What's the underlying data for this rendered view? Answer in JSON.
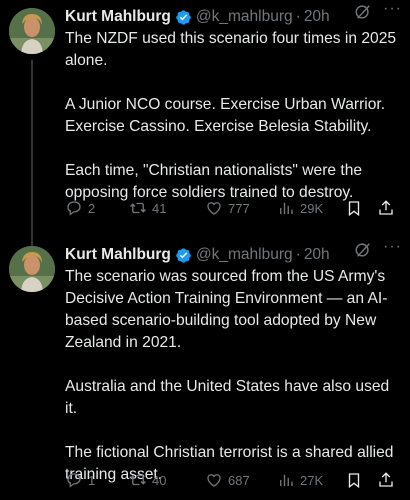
{
  "tweets": [
    {
      "author": "Kurt Mahlburg",
      "handle": "@k_mahlburg",
      "time": "20h",
      "paragraphs": [
        "The NZDF used this scenario four times in 2025 alone.",
        "A Junior NCO course. Exercise Urban Warrior. Exercise Cassino. Exercise Belesia Stability.",
        "Each time, \"Christian nationalists\" were the opposing force soldiers trained to destroy."
      ],
      "replies": "2",
      "reposts": "41",
      "likes": "777",
      "views": "29K"
    },
    {
      "author": "Kurt Mahlburg",
      "handle": "@k_mahlburg",
      "time": "20h",
      "paragraphs": [
        "The scenario was sourced from the US Army's Decisive Action Training Environment — an AI-based scenario-building tool adopted by New Zealand in 2021.",
        "Australia and the United States have also used it.",
        "The fictional Christian terrorist is a shared allied training asset."
      ],
      "replies": "1",
      "reposts": "40",
      "likes": "687",
      "views": "27K"
    }
  ],
  "colors": {
    "background": "#000000",
    "text": "#e7e9ea",
    "muted": "#71767b",
    "verified": "#1d9bf0"
  },
  "icons": [
    "verified-badge-icon",
    "grok-icon",
    "more-icon",
    "reply-icon",
    "repost-icon",
    "like-icon",
    "views-icon",
    "bookmark-icon",
    "share-icon"
  ]
}
